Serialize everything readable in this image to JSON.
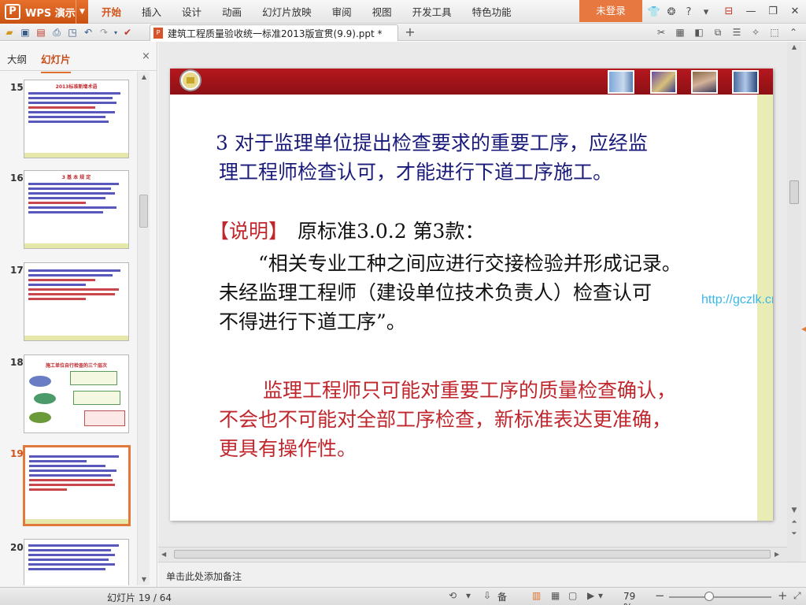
{
  "app": {
    "name": "WPS 演示",
    "logo_letter": "P",
    "login_label": "未登录",
    "menu": [
      {
        "label": "开始",
        "active": true
      },
      {
        "label": "插入"
      },
      {
        "label": "设计"
      },
      {
        "label": "动画"
      },
      {
        "label": "幻灯片放映"
      },
      {
        "label": "审阅"
      },
      {
        "label": "视图"
      },
      {
        "label": "开发工具"
      },
      {
        "label": "特色功能"
      }
    ],
    "title_icons": [
      "shirt-icon",
      "skin-icon",
      "help-icon",
      "collapse-icon",
      "minimize-icon",
      "restore-icon",
      "close-icon"
    ]
  },
  "document": {
    "tab_title": "建筑工程质量验收统一标准2013版宣贯(9.9).ppt *",
    "new_tab_label": "+"
  },
  "left_panel": {
    "tab_outline": "大纲",
    "tab_slides": "幻灯片",
    "close_label": "×",
    "thumbnails": [
      {
        "number": "15",
        "heading": "2013标准新增术语"
      },
      {
        "number": "16",
        "heading": "3 基 本 规 定"
      },
      {
        "number": "17",
        "heading": ""
      },
      {
        "number": "18",
        "heading": "施工单位自行检查的三个层次"
      },
      {
        "number": "19",
        "heading": "",
        "active": true
      },
      {
        "number": "20",
        "heading": ""
      }
    ]
  },
  "slide": {
    "line1": "3  对于监理单位提出检查要求的重要工序，应经监",
    "line2": "理工程师检查认可，才能进行下道工序施工。",
    "note_label": "【说明】",
    "note_text": "原标准3.0.2 第3款：",
    "quote1": "“相关专业工种之间应进行交接检验并形成记录。",
    "quote2": "未经监理工程师（建设单位技术负责人）检查认可",
    "quote3": "不得进行下道工序”。",
    "watermark": "http://gczlk.cn",
    "conclusion1": "监理工程师只可能对重要工序的质量检查确认，",
    "conclusion2": "不会也不可能对全部工序检查，新标准表达更准确，",
    "conclusion3": "更具有操作性。"
  },
  "notes": {
    "placeholder": "单击此处添加备注"
  },
  "status": {
    "slide_counter": "幻灯片 19 / 64",
    "notes_label": "备注",
    "zoom_label": "79 %",
    "zoom_fraction": 0.79
  },
  "colors": {
    "accent": "#e0702e",
    "title_red": "#b5181e",
    "text_blue": "#1a1a7a",
    "text_red": "#c0272d",
    "watermark": "#38b7ea"
  }
}
